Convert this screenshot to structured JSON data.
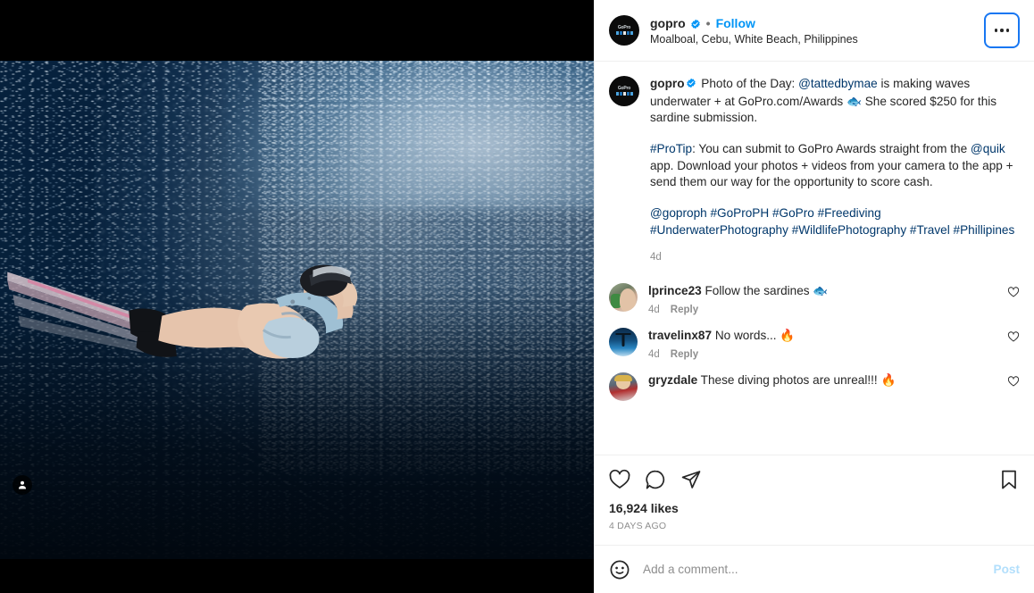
{
  "header": {
    "username": "gopro",
    "verified_icon": "verified-badge-icon",
    "separator": "•",
    "follow_label": "Follow",
    "location": "Moalboal, Cebu, White Beach, Philippines",
    "more_options_icon": "ellipsis-icon",
    "avatar_name": "gopro-avatar"
  },
  "caption": {
    "author": "gopro",
    "verified_icon": "verified-badge-icon",
    "p1_a": " Photo of the Day: ",
    "p1_mention": "@tattedbymae",
    "p1_b": " is making waves underwater + at GoPro.com/Awards ",
    "p1_emoji": "🐟",
    "p1_c": " She scored $250 for this sardine submission.",
    "p2_tag": "#ProTip",
    "p2_a": ": You can submit to GoPro Awards straight from the ",
    "p2_mention": "@quik",
    "p2_b": " app. Download your photos + videos from your camera to the app + send them our way for the opportunity to score cash.",
    "p3_tags": "@goproph #GoProPH #GoPro #Freediving #UnderwaterPhotography #WildlifePhotography #Travel #Phillipines",
    "timestamp": "4d"
  },
  "comments": [
    {
      "username": "lprince23",
      "text": " Follow the sardines 🐟",
      "timestamp": "4d",
      "reply_label": "Reply",
      "avatar_name": "lprince23-avatar",
      "like_icon": "heart-outline-icon"
    },
    {
      "username": "travelinx87",
      "text": " No words... 🔥",
      "timestamp": "4d",
      "reply_label": "Reply",
      "avatar_name": "travelinx87-avatar",
      "like_icon": "heart-outline-icon"
    },
    {
      "username": "gryzdale",
      "text": " These diving photos are unreal!!! 🔥",
      "timestamp": "",
      "reply_label": "",
      "avatar_name": "gryzdale-avatar",
      "like_icon": "heart-outline-icon"
    }
  ],
  "actions": {
    "like_icon": "heart-outline-icon",
    "comment_icon": "speech-bubble-icon",
    "share_icon": "paper-plane-icon",
    "save_icon": "bookmark-outline-icon",
    "likes_count": "16,924 likes",
    "posted_ago": "4 DAYS AGO"
  },
  "add_comment": {
    "emoji_icon": "smiley-face-icon",
    "placeholder": "Add a comment...",
    "value": "",
    "post_label": "Post"
  },
  "media": {
    "alt": "Freediver swimming beside a massive school of sardines underwater",
    "tagged_people_icon": "person-tag-icon"
  },
  "colors": {
    "accent_blue": "#0095f6",
    "link_navy": "#00376b",
    "focus_ring": "#1877f2",
    "text_primary": "#262626",
    "text_muted": "#8e8e8e",
    "divider": "#efefef",
    "post_disabled": "#b2dffc"
  }
}
